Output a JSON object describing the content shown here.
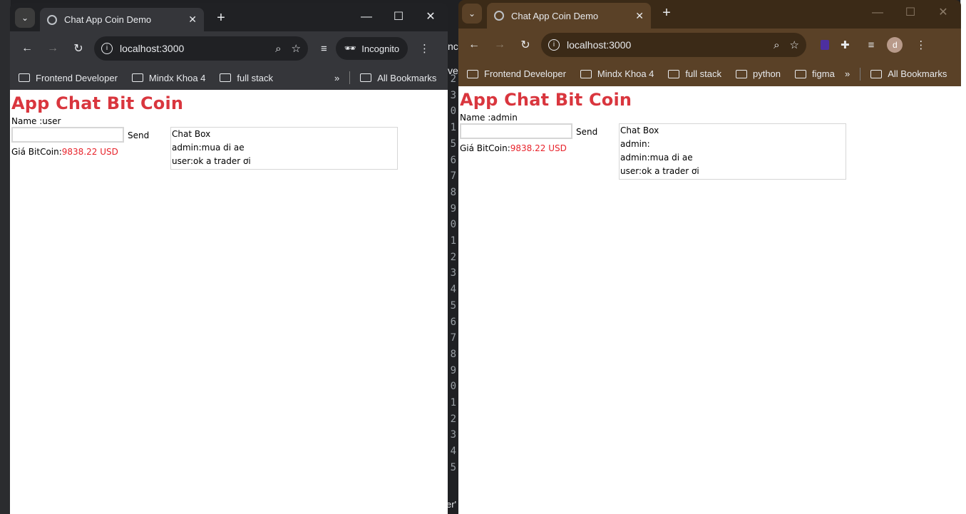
{
  "left_window": {
    "tab_title": "Chat App Coin Demo",
    "url": "localhost:3000",
    "incognito_label": "Incognito",
    "bookmarks": [
      "Frontend Developer",
      "Mindx Khoa 4",
      "full stack"
    ],
    "all_bookmarks": "All Bookmarks",
    "page": {
      "heading": "App Chat Bit Coin",
      "name_line": "Name :user",
      "send_label": "Send",
      "price_label": "Giá BitCoin:",
      "price_value": "9838.22 USD",
      "chat_title": "Chat Box",
      "messages": [
        "admin:mua di ae",
        "user:ok a trader ơi"
      ]
    }
  },
  "right_window": {
    "tab_title": "Chat App Coin Demo",
    "url": "localhost:3000",
    "avatar_letter": "d",
    "bookmarks": [
      "Frontend Developer",
      "Mindx Khoa 4",
      "full stack",
      "python",
      "figma"
    ],
    "all_bookmarks": "All Bookmarks",
    "page": {
      "heading": "App Chat Bit Coin",
      "name_line": "Name :admin",
      "send_label": "Send",
      "price_label": "Giá BitCoin:",
      "price_value": "9838.22 USD",
      "chat_title": "Chat Box",
      "messages": [
        "admin:",
        "admin:mua di ae",
        "user:ok a trader ơi"
      ]
    }
  },
  "background_gutter_digits": [
    "2",
    "3",
    "0",
    "1",
    "5",
    "6",
    "7",
    "8",
    "9",
    "0",
    "1",
    "2",
    "3",
    "4",
    "5",
    "6",
    "7",
    "8",
    "9",
    "0",
    "1",
    "2",
    "3",
    "4",
    "5"
  ],
  "background_snippets": [
    "nc",
    "ve",
    "er'"
  ],
  "colors": {
    "heading_red": "#d9363e",
    "price_red": "#e8232b",
    "incognito_chrome": "#35363a",
    "themed_chrome": "#5a4127"
  }
}
